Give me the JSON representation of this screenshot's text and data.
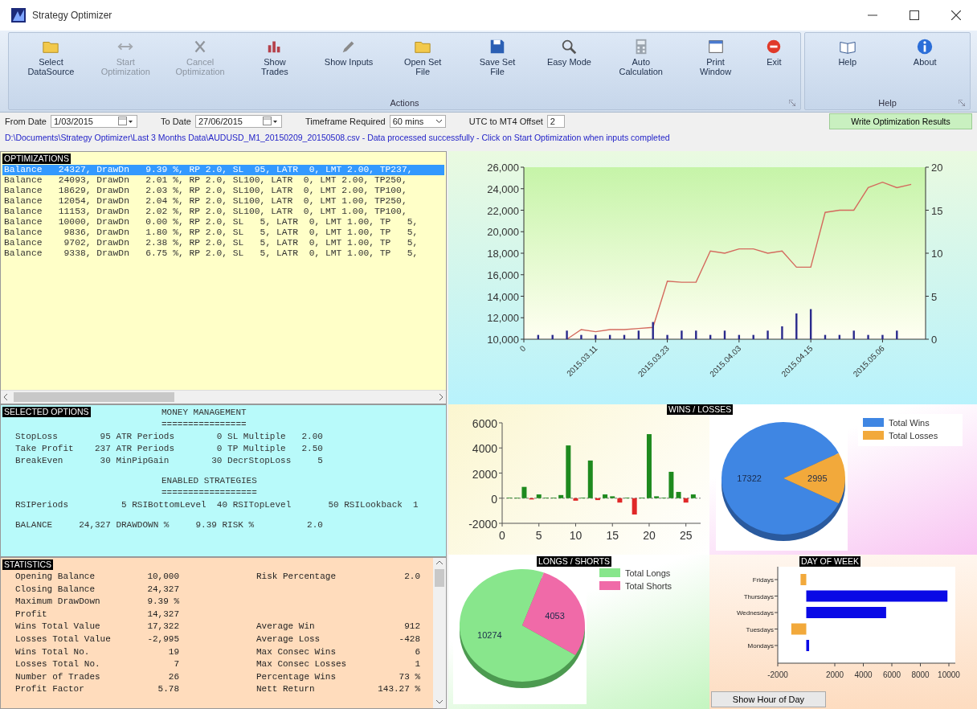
{
  "window": {
    "title": "Strategy Optimizer"
  },
  "ribbon": {
    "groups": [
      {
        "label": "Actions",
        "buttons": [
          {
            "label": "Select DataSource",
            "disabled": false
          },
          {
            "label": "Start Optimization",
            "disabled": true
          },
          {
            "label": "Cancel Optimization",
            "disabled": true
          },
          {
            "label": "Show Trades",
            "disabled": false
          },
          {
            "label": "Show Inputs",
            "disabled": false
          },
          {
            "label": "Open Set File",
            "disabled": false
          },
          {
            "label": "Save Set File",
            "disabled": false
          },
          {
            "label": "Easy Mode",
            "disabled": false
          },
          {
            "label": "Auto Calculation",
            "disabled": false
          },
          {
            "label": "Print Window",
            "disabled": false
          },
          {
            "label": "Exit",
            "disabled": false
          }
        ]
      },
      {
        "label": "Help",
        "buttons": [
          {
            "label": "Help",
            "disabled": false
          },
          {
            "label": "About",
            "disabled": false
          }
        ]
      }
    ]
  },
  "inputs": {
    "from_date": {
      "label": "From Date",
      "value": "1/03/2015"
    },
    "to_date": {
      "label": "To Date",
      "value": "27/06/2015"
    },
    "timeframe": {
      "label": "Timeframe Required",
      "value": "60 mins"
    },
    "utc_offset": {
      "label": "UTC to MT4 Offset",
      "value": "2"
    },
    "write_button": "Write Optimization Results"
  },
  "status_message": "D:\\Documents\\Strategy Optimizer\\Last 3 Months Data\\AUDUSD_M1_20150209_20150508.csv - Data processed successfully - Click on Start Optimization when inputs completed",
  "optimizations": {
    "title": "OPTIMIZATIONS",
    "rows": [
      {
        "text": "Balance   24327, DrawDn   9.39 %, RP 2.0, SL  95, LATR  0, LMT 2.00, TP237,",
        "selected": true
      },
      {
        "text": "Balance   24093, DrawDn   2.01 %, RP 2.0, SL100, LATR  0, LMT 2.00, TP250,",
        "selected": false
      },
      {
        "text": "Balance   18629, DrawDn   2.03 %, RP 2.0, SL100, LATR  0, LMT 2.00, TP100,",
        "selected": false
      },
      {
        "text": "Balance   12054, DrawDn   2.04 %, RP 2.0, SL100, LATR  0, LMT 1.00, TP250,",
        "selected": false
      },
      {
        "text": "Balance   11153, DrawDn   2.02 %, RP 2.0, SL100, LATR  0, LMT 1.00, TP100,",
        "selected": false
      },
      {
        "text": "Balance   10000, DrawDn   0.00 %, RP 2.0, SL   5, LATR  0, LMT 1.00, TP   5,",
        "selected": false
      },
      {
        "text": "Balance    9836, DrawDn   1.80 %, RP 2.0, SL   5, LATR  0, LMT 1.00, TP   5,",
        "selected": false
      },
      {
        "text": "Balance    9702, DrawDn   2.38 %, RP 2.0, SL   5, LATR  0, LMT 1.00, TP   5,",
        "selected": false
      },
      {
        "text": "Balance    9338, DrawDn   6.75 %, RP 2.0, SL   5, LATR  0, LMT 1.00, TP   5,",
        "selected": false
      }
    ]
  },
  "selected_options": {
    "title": "SELECTED OPTIONS",
    "sections": [
      {
        "heading": "MONEY MANAGEMENT",
        "rule": "================",
        "rows": [
          "StopLoss        95 ATR Periods        0 SL Multiple   2.00",
          "Take Profit    237 ATR Periods        0 TP Multiple   2.50",
          "BreakEven       30 MinPipGain        30 DecrStopLoss     5"
        ]
      },
      {
        "heading": "ENABLED STRATEGIES",
        "rule": "==================",
        "rows": [
          "RSIPeriods          5 RSIBottomLevel  40 RSITopLevel       50 RSILookback  1"
        ]
      }
    ],
    "summary": [
      "BALANCE     24,327 DRAWDOWN %     9.39 RISK %          2.0"
    ]
  },
  "statistics": {
    "title": "STATISTICS",
    "rows": [
      {
        "label": "Opening Balance",
        "value": "10,000",
        "label_2": "Risk Percentage",
        "value_2": "2.0"
      },
      {
        "label": "Closing Balance",
        "value": "24,327"
      },
      {
        "label": "Maximum DrawDown",
        "value": "9.39 %"
      },
      {
        "label": "Profit",
        "value": "14,327"
      },
      {
        "label": "Wins Total Value",
        "value": "17,322",
        "label_2": "Average Win",
        "value_2": "912"
      },
      {
        "label": "Losses Total Value",
        "value": "-2,995",
        "label_2": "Average Loss",
        "value_2": "-428"
      },
      {
        "label": "Wins Total No.",
        "value": "19",
        "label_2": "Max Consec Wins",
        "value_2": "6"
      },
      {
        "label": "Losses Total No.",
        "value": "7",
        "label_2": "Max Consec Losses",
        "value_2": "1"
      },
      {
        "label": "Number of Trades",
        "value": "26",
        "label_2": "Percentage Wins",
        "value_2": "73 %"
      },
      {
        "label": "Profit Factor",
        "value": "5.78",
        "label_2": "Nett Return",
        "value_2": "143.27 %"
      }
    ]
  },
  "balance_chart": {
    "chart_data": {
      "type": "line",
      "categories": [
        "0",
        null,
        null,
        null,
        null,
        "2015.03.11",
        null,
        null,
        null,
        null,
        "2015.03.23",
        null,
        null,
        null,
        null,
        "2015.04.03",
        null,
        null,
        null,
        null,
        "2015.04.15",
        null,
        null,
        null,
        null,
        "2015.05.06",
        null,
        null
      ],
      "ylim": [
        10000,
        26000
      ],
      "yticks": [
        {
          "value": 10000,
          "label": "10,000"
        },
        {
          "value": 12000,
          "label": "12,000"
        },
        {
          "value": 14000,
          "label": "14,000"
        },
        {
          "value": 16000,
          "label": "16,000"
        },
        {
          "value": 18000,
          "label": "18,000"
        },
        {
          "value": 20000,
          "label": "20,000"
        },
        {
          "value": 22000,
          "label": "22,000"
        },
        {
          "value": 24000,
          "label": "24,000"
        },
        {
          "value": 26000,
          "label": "26,000"
        }
      ],
      "series": [
        {
          "color": "#d46a5e",
          "values": [
            null,
            null,
            null,
            10000,
            10900,
            10700,
            10900,
            10900,
            11000,
            11100,
            15400,
            15300,
            15300,
            18200,
            18000,
            18400,
            18400,
            18000,
            18200,
            16700,
            16700,
            21800,
            22000,
            22000,
            24100,
            24600,
            24100,
            24400
          ]
        }
      ]
    }
  },
  "trades_chart": {
    "chart_data": {
      "type": "bar",
      "ylim": [
        0,
        20
      ],
      "yticks": [
        0,
        5,
        10,
        15,
        20
      ],
      "series": [
        {
          "color": "#2a2a8c",
          "values": [
            null,
            0.5,
            0.5,
            1,
            0.5,
            0.5,
            0.5,
            0.5,
            1,
            2,
            0.5,
            1,
            1,
            0.5,
            1,
            0.5,
            0.5,
            1,
            1.5,
            3,
            3.5,
            0.5,
            0.5,
            1,
            0.5,
            0.5,
            1,
            null
          ]
        }
      ]
    }
  },
  "wins_losses_bars": {
    "title": "WINS / LOSSES",
    "chart_data": {
      "type": "bar",
      "x": [
        1,
        2,
        3,
        4,
        5,
        6,
        7,
        8,
        9,
        10,
        11,
        12,
        13,
        14,
        15,
        16,
        17,
        18,
        19,
        20,
        21,
        22,
        23,
        24,
        25,
        26
      ],
      "xlim": [
        0,
        27
      ],
      "ylim": [
        -2000,
        6000
      ],
      "xticks": [
        0,
        5,
        10,
        15,
        20,
        25
      ],
      "yticks": [
        -2000,
        0,
        2000,
        4000,
        6000
      ],
      "series": [
        {
          "color": "#1e8a1e",
          "values": [
            50,
            30,
            900,
            null,
            300,
            50,
            50,
            250,
            4200,
            null,
            50,
            3000,
            null,
            300,
            150,
            null,
            50,
            null,
            50,
            5100,
            150,
            50,
            2100,
            500,
            null,
            300
          ]
        },
        {
          "color": "#e02828",
          "values": [
            null,
            null,
            null,
            -100,
            null,
            null,
            null,
            null,
            null,
            -200,
            null,
            null,
            -150,
            null,
            null,
            -350,
            null,
            -1300,
            null,
            null,
            null,
            null,
            null,
            null,
            -350,
            null
          ]
        }
      ]
    }
  },
  "wins_losses_pie": {
    "chart_data": {
      "type": "pie",
      "categories": [
        "Total Wins",
        "Total Losses"
      ],
      "values": [
        17322,
        2995
      ],
      "colors": [
        "#3f86e3",
        "#f2a93b"
      ],
      "data_labels": true,
      "legend": "upper right"
    }
  },
  "longs_shorts_pie": {
    "title": "LONGS / SHORTS",
    "chart_data": {
      "type": "pie",
      "categories": [
        "Total Longs",
        "Total Shorts"
      ],
      "values": [
        10274,
        4053
      ],
      "colors": [
        "#88e68c",
        "#f06aa8"
      ],
      "data_labels": true,
      "legend": "upper right"
    }
  },
  "day_of_week": {
    "title": "DAY OF WEEK",
    "chart_data": {
      "type": "bar",
      "orientation": "horizontal",
      "categories": [
        "Fridays",
        "Thursdays",
        "Wednesdays",
        "Tuesdays",
        "Mondays"
      ],
      "xlim": [
        -2000,
        10000
      ],
      "series": [
        {
          "color": "#0a0ae6",
          "values": [
            null,
            9900,
            5600,
            null,
            200
          ]
        },
        {
          "color": "#f2a93b",
          "values": [
            -400,
            null,
            null,
            -1050,
            null
          ]
        }
      ],
      "xticks": [
        -2000,
        2000,
        4000,
        6000,
        8000,
        10000
      ]
    },
    "button": "Show Hour of Day"
  }
}
